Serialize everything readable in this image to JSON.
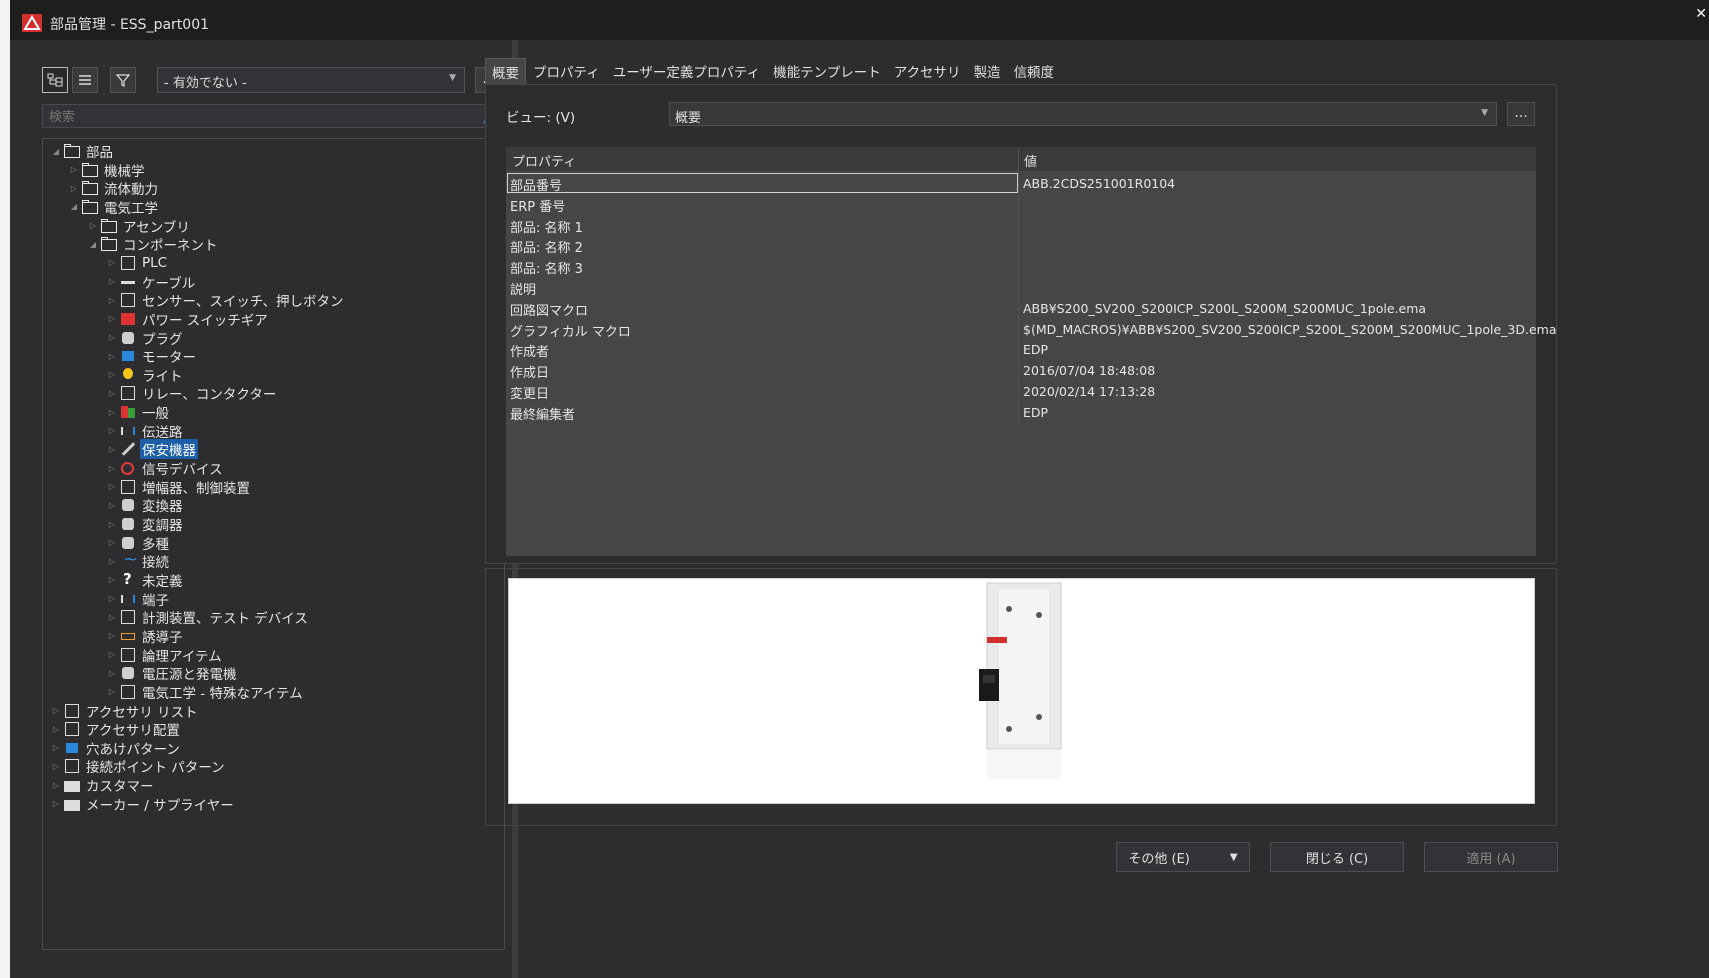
{
  "window": {
    "title": "部品管理 - ESS_part001",
    "close": "✕"
  },
  "left": {
    "filter_value": "- 有効でない -",
    "more_label": "...",
    "search_placeholder": "検索",
    "tree": [
      {
        "label": "部品",
        "level": 0,
        "toggle": "◢",
        "icon": "folder"
      },
      {
        "label": "機械学",
        "level": 1,
        "toggle": "▷",
        "icon": "folder"
      },
      {
        "label": "流体動力",
        "level": 1,
        "toggle": "▷",
        "icon": "folder"
      },
      {
        "label": "電気工学",
        "level": 1,
        "toggle": "◢",
        "icon": "folder"
      },
      {
        "label": "アセンブリ",
        "level": 2,
        "toggle": "▷",
        "icon": "folder"
      },
      {
        "label": "コンポーネント",
        "level": 2,
        "toggle": "◢",
        "icon": "folder"
      },
      {
        "label": "PLC",
        "level": 3,
        "toggle": "▷",
        "icon": "sq"
      },
      {
        "label": "ケーブル",
        "level": 3,
        "toggle": "▷",
        "icon": "dash"
      },
      {
        "label": "センサー、スイッチ、押しボタン",
        "level": 3,
        "toggle": "▷",
        "icon": "sq"
      },
      {
        "label": "パワー スイッチギア",
        "level": 3,
        "toggle": "▷",
        "icon": "redblock"
      },
      {
        "label": "プラグ",
        "level": 3,
        "toggle": "▷",
        "icon": "gray"
      },
      {
        "label": "モーター",
        "level": 3,
        "toggle": "▷",
        "icon": "blue"
      },
      {
        "label": "ライト",
        "level": 3,
        "toggle": "▷",
        "icon": "bulb"
      },
      {
        "label": "リレー、コンタクター",
        "level": 3,
        "toggle": "▷",
        "icon": "sq"
      },
      {
        "label": "一般",
        "level": 3,
        "toggle": "▷",
        "icon": "multi"
      },
      {
        "label": "伝送路",
        "level": 3,
        "toggle": "▷",
        "icon": "bars"
      },
      {
        "label": "保安機器",
        "level": 3,
        "toggle": "▷",
        "icon": "diag",
        "selected": true
      },
      {
        "label": "信号デバイス",
        "level": 3,
        "toggle": "▷",
        "icon": "red"
      },
      {
        "label": "増幅器、制御装置",
        "level": 3,
        "toggle": "▷",
        "icon": "sq"
      },
      {
        "label": "変換器",
        "level": 3,
        "toggle": "▷",
        "icon": "gray"
      },
      {
        "label": "変調器",
        "level": 3,
        "toggle": "▷",
        "icon": "gray"
      },
      {
        "label": "多種",
        "level": 3,
        "toggle": "▷",
        "icon": "gray"
      },
      {
        "label": "接続",
        "level": 3,
        "toggle": "▷",
        "icon": "wave"
      },
      {
        "label": "未定義",
        "level": 3,
        "toggle": "▷",
        "icon": "q"
      },
      {
        "label": "端子",
        "level": 3,
        "toggle": "▷",
        "icon": "bars"
      },
      {
        "label": "計測装置、テスト デバイス",
        "level": 3,
        "toggle": "▷",
        "icon": "sq"
      },
      {
        "label": "誘導子",
        "level": 3,
        "toggle": "▷",
        "icon": "orange"
      },
      {
        "label": "論理アイテム",
        "level": 3,
        "toggle": "▷",
        "icon": "sq"
      },
      {
        "label": "電圧源と発電機",
        "level": 3,
        "toggle": "▷",
        "icon": "gray"
      },
      {
        "label": "電気工学 - 特殊なアイテム",
        "level": 3,
        "toggle": "▷",
        "icon": "sq"
      },
      {
        "label": "アクセサリ リスト",
        "level": 0,
        "toggle": "▷",
        "icon": "sq"
      },
      {
        "label": "アクセサリ配置",
        "level": 0,
        "toggle": "▷",
        "icon": "sq"
      },
      {
        "label": "穴あけパターン",
        "level": 0,
        "toggle": "▷",
        "icon": "blue"
      },
      {
        "label": "接続ポイント パターン",
        "level": 0,
        "toggle": "▷",
        "icon": "sq"
      },
      {
        "label": "カスタマー",
        "level": 0,
        "toggle": "▷",
        "icon": "factory"
      },
      {
        "label": "メーカー / サプライヤー",
        "level": 0,
        "toggle": "▷",
        "icon": "factory"
      }
    ]
  },
  "tabs": [
    "概要",
    "プロパティ",
    "ユーザー定義プロパティ",
    "機能テンプレート",
    "アクセサリ",
    "製造",
    "信頼度"
  ],
  "view": {
    "label": "ビュー: (V)",
    "value": "概要",
    "more": "..."
  },
  "grid": {
    "col_property": "プロパティ",
    "col_value": "値",
    "rows": [
      {
        "k": "部品番号",
        "v": "ABB.2CDS251001R0104"
      },
      {
        "k": "ERP 番号",
        "v": ""
      },
      {
        "k": "部品: 名称 1",
        "v": ""
      },
      {
        "k": "部品: 名称 2",
        "v": ""
      },
      {
        "k": "部品: 名称 3",
        "v": ""
      },
      {
        "k": "説明",
        "v": ""
      },
      {
        "k": "回路図マクロ",
        "v": "ABB¥S200_SV200_S200ICP_S200L_S200M_S200MUC_1pole.ema"
      },
      {
        "k": "グラフィカル マクロ",
        "v": "$(MD_MACROS)¥ABB¥S200_SV200_S200ICP_S200L_S200M_S200MUC_1pole_3D.ema"
      },
      {
        "k": "作成者",
        "v": "EDP"
      },
      {
        "k": "作成日",
        "v": "2016/07/04 18:48:08"
      },
      {
        "k": "変更日",
        "v": "2020/02/14 17:13:28"
      },
      {
        "k": "最終編集者",
        "v": "EDP"
      }
    ]
  },
  "buttons": {
    "other": "その他 (E)",
    "close": "閉じる (C)",
    "apply": "適用 (A)"
  }
}
